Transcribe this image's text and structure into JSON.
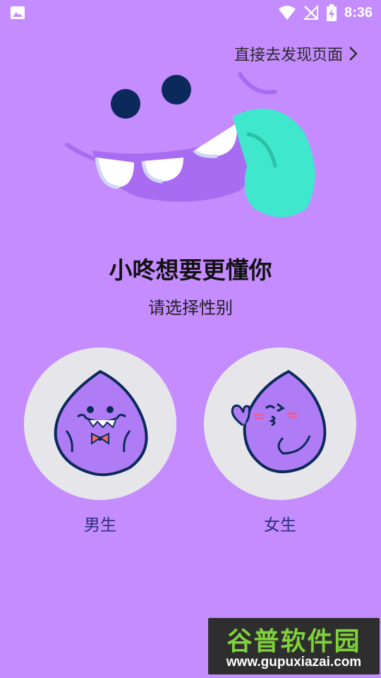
{
  "status_bar": {
    "time": "8:36",
    "icons": [
      "image-icon",
      "wifi-icon",
      "no-signal-icon",
      "battery-charging-icon"
    ]
  },
  "skip_link": {
    "label": "直接去发现页面",
    "icon": "chevron-right-icon"
  },
  "mascot": {
    "icon": "monster-mouth-illustration",
    "body_color": "#a86cf2",
    "tongue_color": "#3fe8cc",
    "eye_color": "#0b2a5b"
  },
  "title": "小咚想要更懂你",
  "subtitle": "请选择性别",
  "genders": [
    {
      "label": "男生",
      "icon": "male-mascot-icon"
    },
    {
      "label": "女生",
      "icon": "female-mascot-icon"
    }
  ],
  "watermark": {
    "title": "谷普软件园",
    "url": "www.gupuxiazai.com"
  },
  "colors": {
    "background": "#c48cff",
    "circle": "#e6e6ea",
    "label": "#2c2e7a"
  }
}
